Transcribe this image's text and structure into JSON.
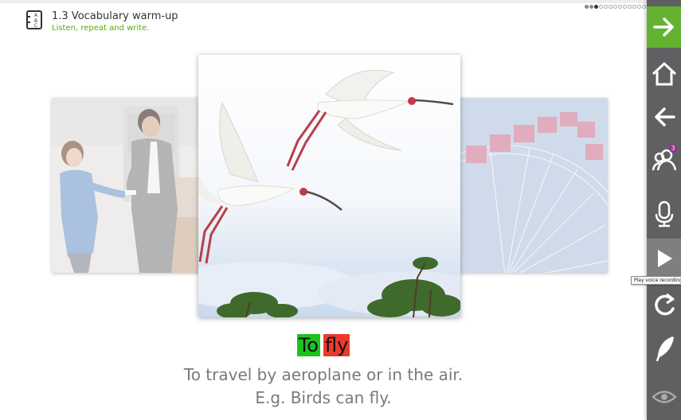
{
  "header": {
    "title": "1.3 Vocabulary warm-up",
    "subtitle": "Listen, repeat and write.",
    "icon": "abc-book-icon"
  },
  "progress": {
    "total_pages": 17,
    "current_page": 3
  },
  "cards": {
    "left": "photo-people",
    "center": "photo-birds-flying",
    "right": "photo-ferris-wheel"
  },
  "vocabulary": {
    "word_parts": [
      "To",
      "fly"
    ],
    "definition": "To travel by aeroplane or in the air.",
    "example": "E.g. Birds can fly.",
    "highlight_colors": [
      "#1ec21e",
      "#ea3a2e"
    ]
  },
  "toolbar": {
    "items": [
      {
        "name": "next",
        "icon": "arrow-right-icon"
      },
      {
        "name": "home",
        "icon": "home-icon"
      },
      {
        "name": "back",
        "icon": "arrow-left-icon"
      },
      {
        "name": "team",
        "icon": "users-icon",
        "badge": "3"
      },
      {
        "name": "record",
        "icon": "microphone-icon"
      },
      {
        "name": "play",
        "icon": "play-icon",
        "tooltip": "Play voice recording"
      },
      {
        "name": "redo",
        "icon": "redo-icon"
      },
      {
        "name": "write",
        "icon": "feather-pen-icon"
      },
      {
        "name": "show",
        "icon": "eye-icon"
      }
    ],
    "accent": "#64b232",
    "background": "#5e6062"
  }
}
